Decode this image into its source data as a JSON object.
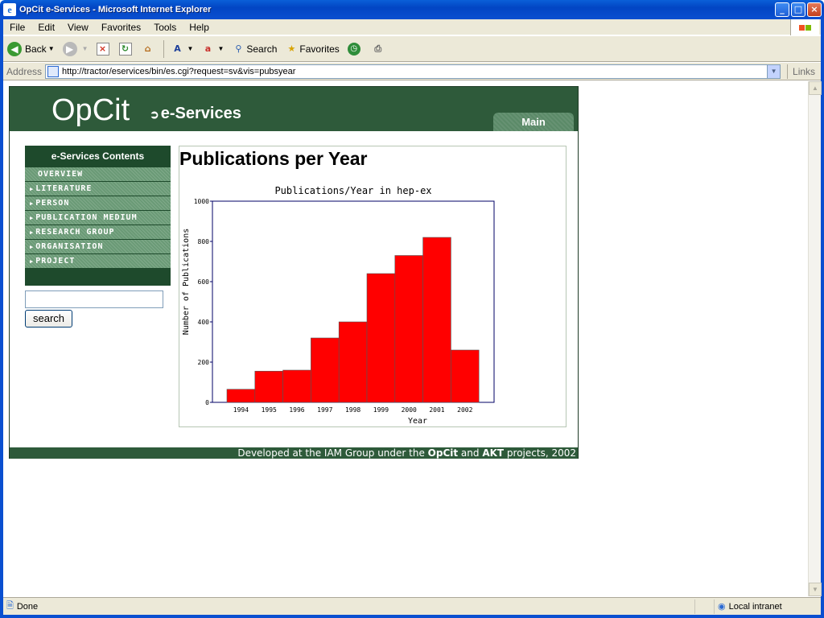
{
  "window": {
    "title": "OpCit e-Services - Microsoft Internet Explorer",
    "buttons": [
      "_",
      "□",
      "×"
    ]
  },
  "menu": [
    "File",
    "Edit",
    "View",
    "Favorites",
    "Tools",
    "Help"
  ],
  "toolbar": {
    "back": "Back",
    "search": "Search",
    "favorites": "Favorites"
  },
  "address": {
    "label": "Address",
    "url": "http://tractor/eservices/bin/es.cgi?request=sv&vis=pubsyear",
    "links": "Links"
  },
  "status": {
    "text": "Done",
    "zone": "Local intranet"
  },
  "site": {
    "logo": "OpCit",
    "logo_sub": "e-Services",
    "main_tab": "Main",
    "sidebar_title": "e-Services Contents",
    "nav": [
      "Overview",
      "Literature",
      "Person",
      "Publication Medium",
      "Research Group",
      "Organisation",
      "Project"
    ],
    "search_button": "search",
    "search_value": "",
    "page_title": "Publications per Year",
    "footer_prefix": "Developed at the IAM Group under the ",
    "footer_b1": "OpCit",
    "footer_mid": " and ",
    "footer_b2": "AKT",
    "footer_suffix": " projects, 2002"
  },
  "colors": {
    "header_green": "#2e5a3a",
    "bar_red": "#ff0000"
  },
  "chart_data": {
    "type": "bar",
    "title": "Publications/Year in hep-ex",
    "xlabel": "Year",
    "ylabel": "Number of Publications",
    "categories": [
      "1994",
      "1995",
      "1996",
      "1997",
      "1998",
      "1999",
      "2000",
      "2001",
      "2002"
    ],
    "values": [
      65,
      155,
      160,
      320,
      400,
      640,
      730,
      820,
      260
    ],
    "ylim": [
      0,
      1000
    ],
    "yticks": [
      0,
      200,
      400,
      600,
      800,
      1000
    ],
    "grid": false
  }
}
